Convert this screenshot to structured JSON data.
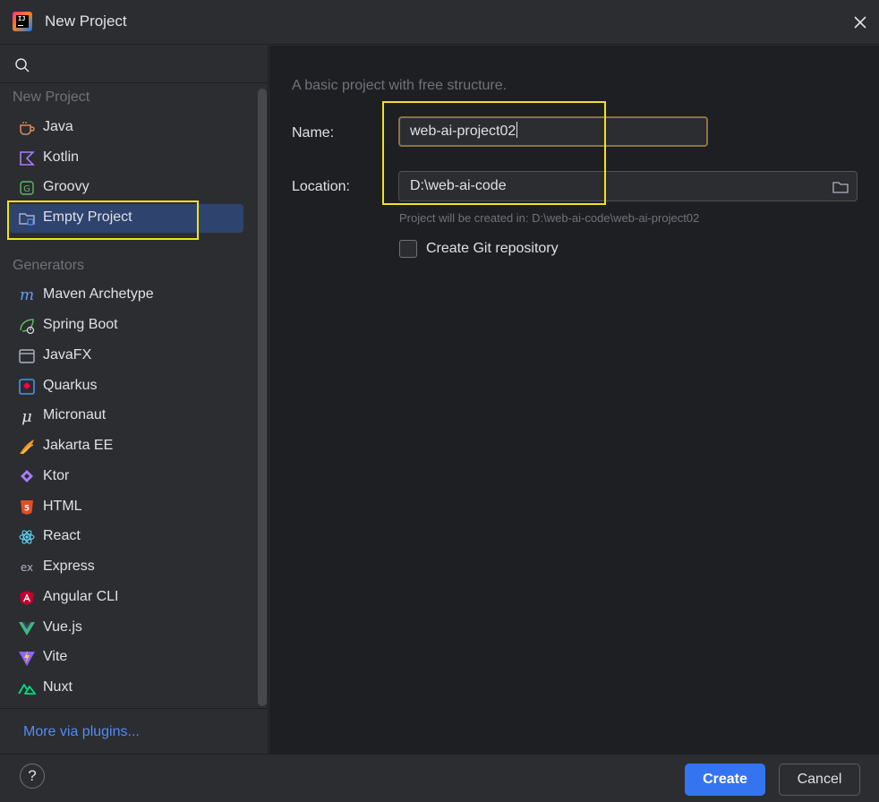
{
  "window": {
    "title": "New Project"
  },
  "sidebar": {
    "search_placeholder": "",
    "new_project_label": "New Project",
    "generators_label": "Generators",
    "new_project_items": [
      {
        "label": "Java",
        "icon": "java-cup-icon",
        "selected": false
      },
      {
        "label": "Kotlin",
        "icon": "kotlin-icon",
        "selected": false
      },
      {
        "label": "Groovy",
        "icon": "groovy-icon",
        "selected": false
      },
      {
        "label": "Empty Project",
        "icon": "empty-project-folder-icon",
        "selected": true
      }
    ],
    "generator_items": [
      {
        "label": "Maven Archetype",
        "icon": "maven-icon"
      },
      {
        "label": "Spring Boot",
        "icon": "spring-boot-icon"
      },
      {
        "label": "JavaFX",
        "icon": "javafx-window-icon"
      },
      {
        "label": "Quarkus",
        "icon": "quarkus-icon"
      },
      {
        "label": "Micronaut",
        "icon": "micronaut-icon"
      },
      {
        "label": "Jakarta EE",
        "icon": "jakarta-ee-icon"
      },
      {
        "label": "Ktor",
        "icon": "ktor-icon"
      },
      {
        "label": "HTML",
        "icon": "html5-icon"
      },
      {
        "label": "React",
        "icon": "react-icon"
      },
      {
        "label": "Express",
        "icon": "express-icon"
      },
      {
        "label": "Angular CLI",
        "icon": "angular-icon"
      },
      {
        "label": "Vue.js",
        "icon": "vue-icon"
      },
      {
        "label": "Vite",
        "icon": "vite-icon"
      },
      {
        "label": "Nuxt",
        "icon": "nuxt-icon"
      }
    ],
    "more_plugins": "More via plugins..."
  },
  "main": {
    "description": "A basic project with free structure.",
    "name_label": "Name:",
    "name_value": "web-ai-project02",
    "location_label": "Location:",
    "location_value": "D:\\web-ai-code",
    "hint": "Project will be created in: D:\\web-ai-code\\web-ai-project02",
    "git_checkbox_label": "Create Git repository",
    "git_checked": false
  },
  "footer": {
    "help": "?",
    "create": "Create",
    "cancel": "Cancel"
  },
  "colors": {
    "background": "#2b2d30",
    "content_background": "#1e1f22",
    "selection": "#2e436e",
    "accent_button": "#3574f0",
    "link": "#548af7",
    "highlight_box": "#f0e31a"
  }
}
